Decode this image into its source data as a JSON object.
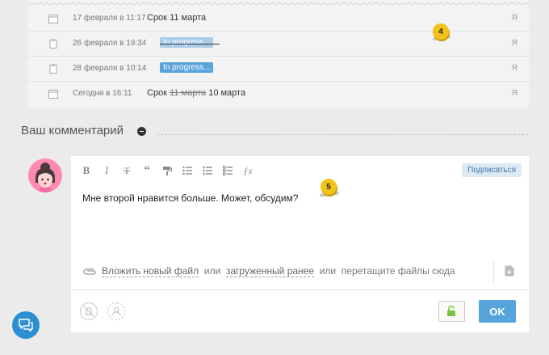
{
  "history": {
    "rows": [
      {
        "date": "17 февраля в 11:17",
        "label": "Срок",
        "value": "11 марта",
        "who": "Я"
      },
      {
        "date": "26 февраля в 19:34",
        "tag": "In progress...",
        "who": "Я"
      },
      {
        "date": "28 февраля в 10:14",
        "tag": "In progress...",
        "who": "Я"
      },
      {
        "date": "Сегодня в 16:11",
        "label": "Срок",
        "old_value": "11 марта",
        "value": "10 марта",
        "who": "Я"
      }
    ]
  },
  "badges": {
    "b4": "4",
    "b5": "5"
  },
  "comment": {
    "title": "Ваш комментарий",
    "subscribe": "Подписаться",
    "text": "Мне второй нравится больше. Может, обсудим?",
    "attach": {
      "upload": "Вложить новый файл",
      "or1": "или",
      "uploaded": "загруженный ранее",
      "or2": "или",
      "drag": "перетащите файлы сюда"
    },
    "ok": "OK"
  },
  "icons": [
    "calendar-icon",
    "clipboard-icon",
    "bold-icon",
    "italic-icon",
    "strikethrough-icon",
    "quote-icon",
    "paint-roller-icon",
    "bulleted-list-icon",
    "numbered-list-icon",
    "checklist-icon",
    "formula-icon",
    "paperclip-icon",
    "add-document-icon",
    "mute-bell-icon",
    "assignee-icon",
    "unlock-icon",
    "chat-icon"
  ],
  "colors": {
    "accent": "#55a4da",
    "badge": "#f2c21a",
    "avatar": "#ff8ab1"
  }
}
